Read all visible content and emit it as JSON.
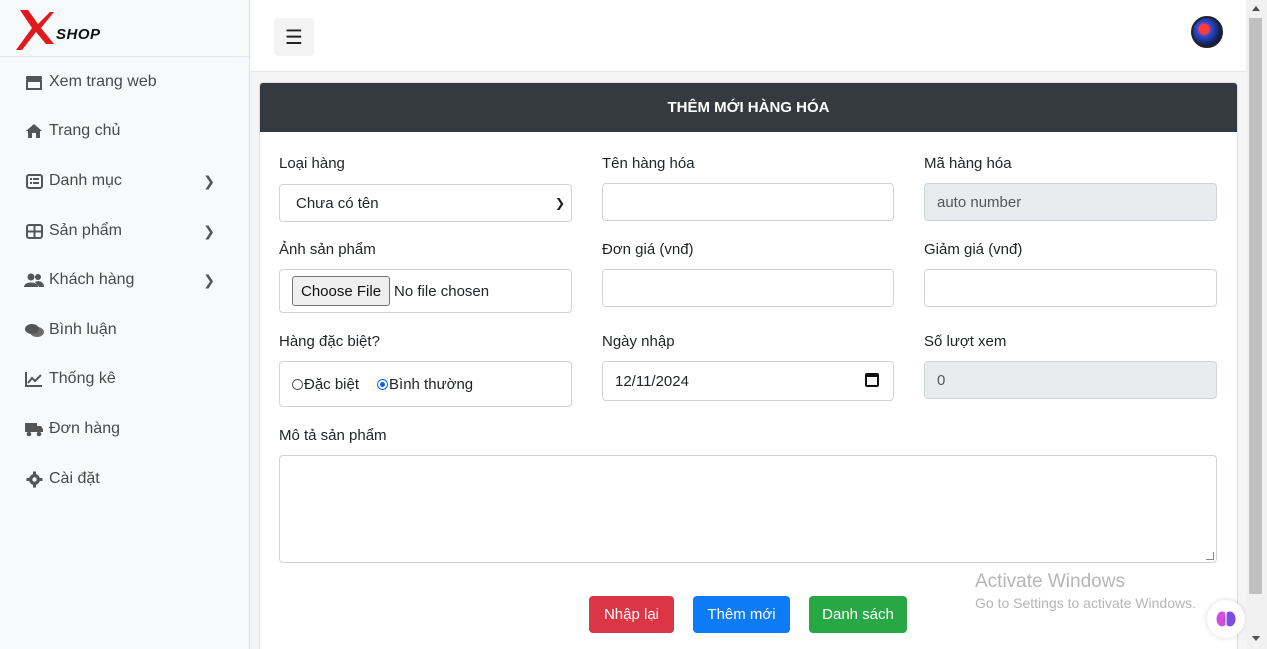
{
  "brand": {
    "name": "SHOP",
    "logo_letter": "X"
  },
  "sidebar": {
    "items": [
      {
        "label": "Xem trang web",
        "icon": "store-icon",
        "has_submenu": false
      },
      {
        "label": "Trang chủ",
        "icon": "home-icon",
        "has_submenu": false
      },
      {
        "label": "Danh mục",
        "icon": "list-icon",
        "has_submenu": true
      },
      {
        "label": "Sản phẩm",
        "icon": "table-icon",
        "has_submenu": true
      },
      {
        "label": "Khách hàng",
        "icon": "users-icon",
        "has_submenu": true
      },
      {
        "label": "Bình luận",
        "icon": "comments-icon",
        "has_submenu": false
      },
      {
        "label": "Thống kê",
        "icon": "chart-line-icon",
        "has_submenu": false
      },
      {
        "label": "Đơn hàng",
        "icon": "truck-icon",
        "has_submenu": false
      },
      {
        "label": "Cài đặt",
        "icon": "gear-icon",
        "has_submenu": false
      }
    ]
  },
  "topbar": {
    "menu_icon": "☰"
  },
  "form": {
    "title": "THÊM MỚI HÀNG HÓA",
    "category": {
      "label": "Loại hàng",
      "selected": "Chưa có tên"
    },
    "name": {
      "label": "Tên hàng hóa",
      "value": ""
    },
    "code": {
      "label": "Mã hàng hóa",
      "value": "auto number"
    },
    "image": {
      "label": "Ảnh sản phẩm",
      "button": "Choose File",
      "status": "No file chosen"
    },
    "price": {
      "label": "Đơn giá (vnđ)",
      "value": ""
    },
    "discount": {
      "label": "Giảm giá (vnđ)",
      "value": ""
    },
    "special": {
      "label": "Hàng đặc biệt?",
      "options": [
        "Đặc biệt",
        "Bình thường"
      ],
      "selected": "Bình thường"
    },
    "date": {
      "label": "Ngày nhập",
      "value": "12/11/2024"
    },
    "views": {
      "label": "Số lượt xem",
      "value": "0"
    },
    "description": {
      "label": "Mô tả sản phẩm",
      "value": ""
    },
    "buttons": {
      "reset": "Nhập lại",
      "add": "Thêm mới",
      "list": "Danh sách"
    }
  },
  "watermark": {
    "line1": "Activate Windows",
    "line2": "Go to Settings to activate Windows."
  },
  "colors": {
    "header": "#343a40",
    "danger": "#dc3545",
    "primary": "#0d7bf5",
    "success": "#28a745",
    "brand_red": "#e0191e"
  }
}
